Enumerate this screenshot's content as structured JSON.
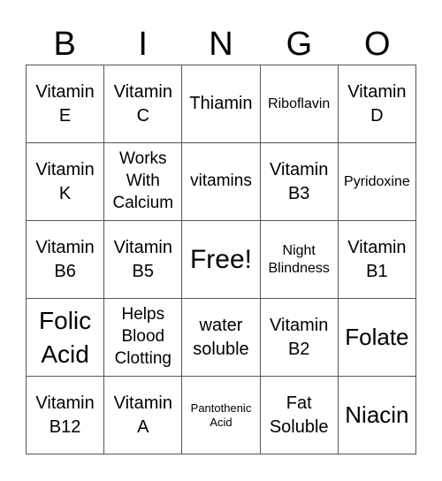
{
  "header": [
    "B",
    "I",
    "N",
    "G",
    "O"
  ],
  "cells": [
    {
      "text": "Vitamin E",
      "size": "md"
    },
    {
      "text": "Vitamin C",
      "size": "md"
    },
    {
      "text": "Thiamin",
      "size": "md"
    },
    {
      "text": "Riboflavin",
      "size": "xs"
    },
    {
      "text": "Vitamin D",
      "size": "md"
    },
    {
      "text": "Vitamin K",
      "size": "md"
    },
    {
      "text": "Works With Calcium",
      "size": "sm"
    },
    {
      "text": "vitamins",
      "size": "sm"
    },
    {
      "text": "Vitamin B3",
      "size": "md"
    },
    {
      "text": "Pyridoxine",
      "size": "xs"
    },
    {
      "text": "Vitamin B6",
      "size": "md"
    },
    {
      "text": "Vitamin B5",
      "size": "md"
    },
    {
      "text": "Free!",
      "size": "free"
    },
    {
      "text": "Night Blindness",
      "size": "xs"
    },
    {
      "text": "Vitamin B1",
      "size": "md"
    },
    {
      "text": "Folic Acid",
      "size": "lg"
    },
    {
      "text": "Helps Blood Clotting",
      "size": "sm"
    },
    {
      "text": "water soluble",
      "size": "md"
    },
    {
      "text": "Vitamin B2",
      "size": "md"
    },
    {
      "text": "Folate",
      "size": "lg2"
    },
    {
      "text": "Vitamin B12",
      "size": "md"
    },
    {
      "text": "Vitamin A",
      "size": "md"
    },
    {
      "text": "Pantothenic Acid",
      "size": "xxs"
    },
    {
      "text": "Fat Soluble",
      "size": "md"
    },
    {
      "text": "Niacin",
      "size": "lg2"
    }
  ]
}
